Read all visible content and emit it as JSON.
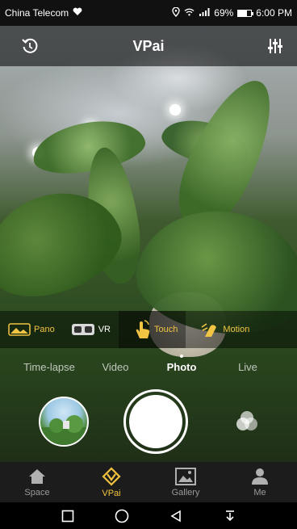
{
  "status_bar": {
    "carrier": "China Telecom",
    "battery": "69%",
    "battery_level": 0.69,
    "time": "6:00 PM"
  },
  "top_bar": {
    "title": "VPai",
    "left_icon": "rotate-undo-icon",
    "right_icon": "sliders-settings-icon"
  },
  "modes": [
    {
      "label": "Pano",
      "icon": "panorama-icon",
      "active": false
    },
    {
      "label": "VR",
      "icon": "vr-headset-icon",
      "active": false
    },
    {
      "label": "Touch",
      "icon": "touch-hand-icon",
      "active": true
    },
    {
      "label": "Motion",
      "icon": "motion-icon",
      "active": false
    }
  ],
  "capture_types": [
    {
      "label": "Time-lapse",
      "active": false
    },
    {
      "label": "Video",
      "active": false
    },
    {
      "label": "Photo",
      "active": true
    },
    {
      "label": "Live",
      "active": false
    }
  ],
  "controls": {
    "thumbnail_icon": "gallery-thumbnail",
    "shutter_icon": "shutter-button",
    "filter_icon": "filter-circles-icon"
  },
  "bottom_nav": [
    {
      "label": "Space",
      "icon": "home-icon",
      "active": false
    },
    {
      "label": "VPai",
      "icon": "vpai-icon",
      "active": true
    },
    {
      "label": "Gallery",
      "icon": "image-icon",
      "active": false
    },
    {
      "label": "Me",
      "icon": "person-icon",
      "active": false
    }
  ],
  "colors": {
    "accent": "#f2c33c",
    "inactive": "#9a9a9a"
  }
}
